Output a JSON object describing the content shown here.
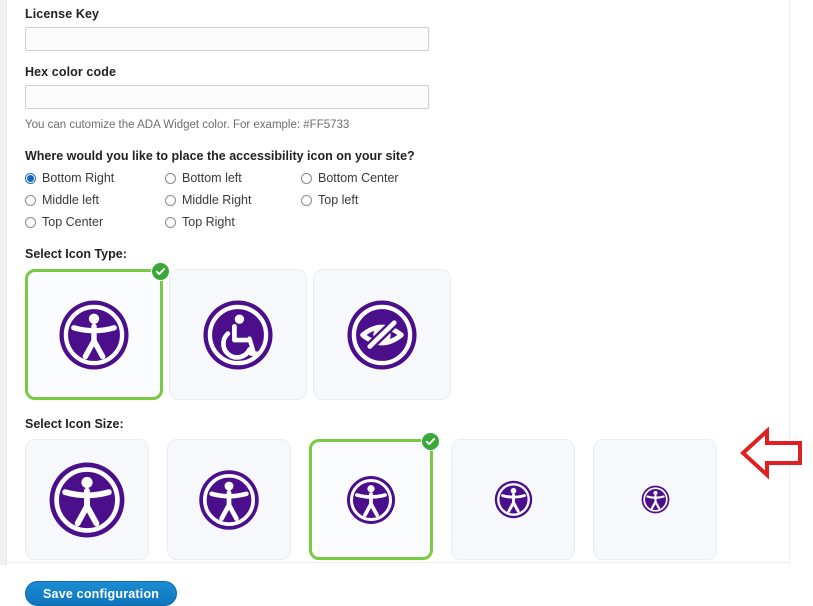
{
  "form": {
    "license_key": {
      "label": "License Key",
      "value": "",
      "placeholder": ""
    },
    "hex_color_code": {
      "label": "Hex color code",
      "value": "",
      "placeholder": "",
      "helper_text": "You can cutomize the ADA Widget color. For example: #FF5733"
    },
    "placement": {
      "question": "Where would you like to place the accessibility icon on your site?",
      "selected": "Bottom Right",
      "options": [
        {
          "label": "Bottom Right",
          "checked": true
        },
        {
          "label": "Bottom left",
          "checked": false
        },
        {
          "label": "Bottom Center",
          "checked": false
        },
        {
          "label": "Middle left",
          "checked": false
        },
        {
          "label": "Middle Right",
          "checked": false
        },
        {
          "label": "Top left",
          "checked": false
        },
        {
          "label": "Top Center",
          "checked": false
        },
        {
          "label": "Top Right",
          "checked": false
        }
      ]
    },
    "icon_type": {
      "label": "Select Icon Type:",
      "selected_index": 0,
      "options": [
        {
          "icon": "accessibility-person-icon",
          "selected": true
        },
        {
          "icon": "wheelchair-icon",
          "selected": false
        },
        {
          "icon": "eye-slash-icon",
          "selected": false
        }
      ]
    },
    "icon_size": {
      "label": "Select Icon Size:",
      "selected_index": 2,
      "options": [
        {
          "icon": "accessibility-person-icon",
          "size": 78,
          "selected": false
        },
        {
          "icon": "accessibility-person-icon",
          "size": 62,
          "selected": false
        },
        {
          "icon": "accessibility-person-icon",
          "size": 50,
          "selected": true
        },
        {
          "icon": "accessibility-person-icon",
          "size": 39,
          "selected": false
        },
        {
          "icon": "accessibility-person-icon",
          "size": 29,
          "selected": false
        }
      ]
    },
    "save": {
      "label": "Save configuration"
    }
  },
  "annotation": {
    "arrow": "left-pointing-arrow",
    "color": "#e02020"
  },
  "colors": {
    "icon_purple": "#4b0f8c",
    "selected_border_green": "#7ac943",
    "badge_green": "#3aa93a",
    "button_blue": "#1580c8",
    "radio_blue": "#1668bd"
  }
}
